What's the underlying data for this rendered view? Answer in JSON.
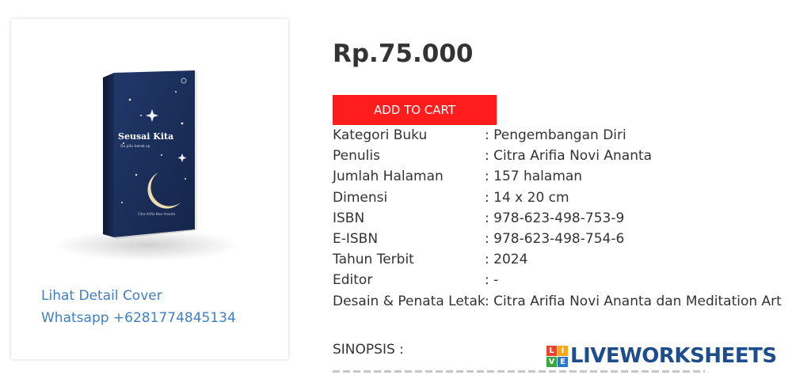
{
  "product": {
    "cover": {
      "title": "Seusai Kita",
      "subtitle": "Ilu pilu berak sp",
      "author": "Citra Arifia Novi Ananta"
    },
    "links": {
      "detail_cover": "Lihat Detail Cover",
      "whatsapp": "Whatsapp +6281774845134"
    },
    "price": "Rp.75.000",
    "cart_button": "ADD TO CART",
    "details": [
      {
        "label": "Kategori Buku",
        "value": ": Pengembangan Diri"
      },
      {
        "label": "Penulis",
        "value": ": Citra Arifia Novi Ananta"
      },
      {
        "label": "Jumlah Halaman",
        "value": ": 157 halaman"
      },
      {
        "label": "Dimensi",
        "value": ": 14 x 20 cm"
      },
      {
        "label": "ISBN",
        "value": ": 978-623-498-753-9"
      },
      {
        "label": "E-ISBN",
        "value": ": 978-623-498-754-6"
      },
      {
        "label": "Tahun Terbit",
        "value": ": 2024"
      },
      {
        "label": "Editor",
        "value": ": -"
      },
      {
        "label": "Desain & Penata Letak",
        "value": ": Citra Arifia Novi Ananta dan Meditation Art"
      }
    ],
    "sinopsis_label": "SINOPSIS :"
  },
  "watermark": {
    "badge_letters": [
      "L",
      "I",
      "V",
      "E"
    ],
    "badge_colors": [
      "#e8452c",
      "#f4a81c",
      "#3aa53a",
      "#2a78c8"
    ],
    "text": "LIVEWORKSHEETS"
  },
  "colors": {
    "price": "#333333",
    "cart_button": "#ff1c1c",
    "link": "#3f7fbf",
    "book_cover": "#1b2d52"
  }
}
